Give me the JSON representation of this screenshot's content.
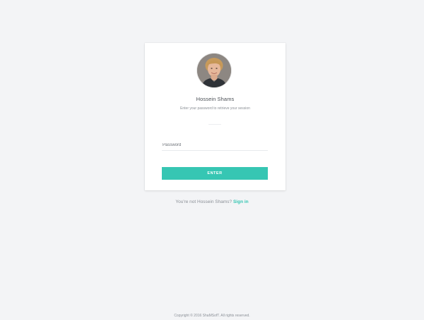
{
  "lock_screen": {
    "user_name": "Hossein Shams",
    "subtitle": "Enter your password to retrieve your session",
    "password_placeholder": "Password",
    "enter_button": "ENTER"
  },
  "switch_user": {
    "prompt": "You're not Hossein Shams?",
    "sign_in_label": "Sign in"
  },
  "footer": {
    "copyright": "Copyright © 2016 ShaMSofT. All rights reserved."
  },
  "colors": {
    "accent": "#36c6b3",
    "background": "#f3f4f6",
    "card": "#ffffff"
  }
}
